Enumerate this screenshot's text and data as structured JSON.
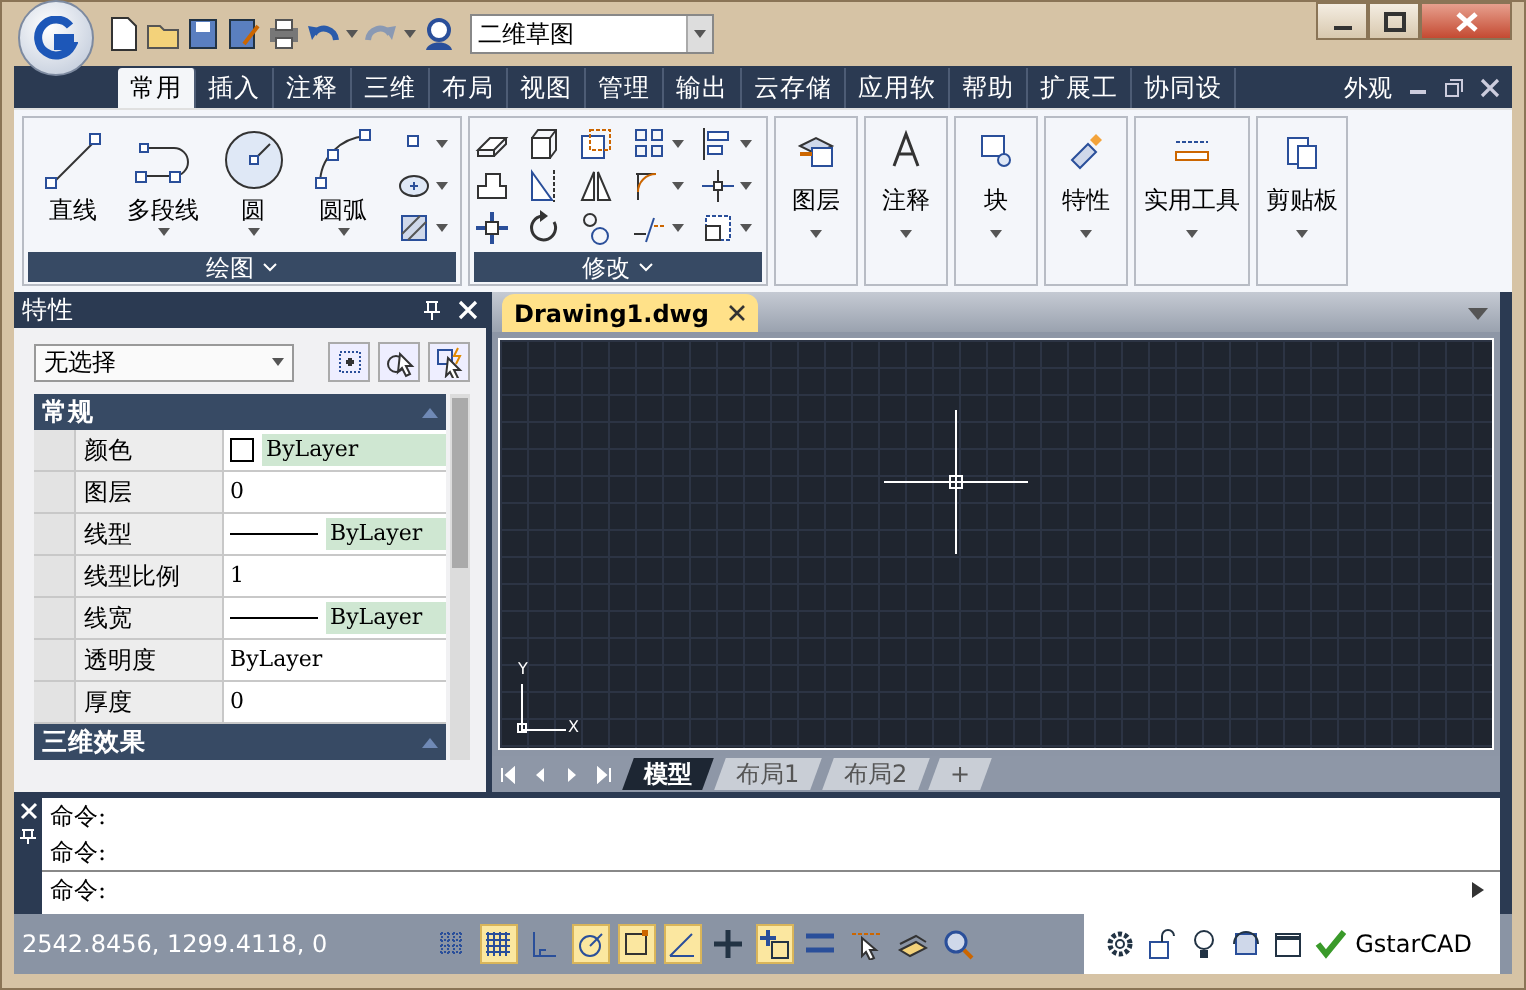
{
  "workspace": {
    "value": "二维草图"
  },
  "ribbon_tabs": [
    {
      "label": "常用",
      "selected": true
    },
    {
      "label": "插入",
      "selected": false
    },
    {
      "label": "注释",
      "selected": false
    },
    {
      "label": "三维",
      "selected": false
    },
    {
      "label": "布局",
      "selected": false
    },
    {
      "label": "视图",
      "selected": false
    },
    {
      "label": "管理",
      "selected": false
    },
    {
      "label": "输出",
      "selected": false
    },
    {
      "label": "云存储",
      "selected": false
    },
    {
      "label": "应用软",
      "selected": false
    },
    {
      "label": "帮助",
      "selected": false
    },
    {
      "label": "扩展工",
      "selected": false
    },
    {
      "label": "协同设",
      "selected": false
    }
  ],
  "appearance_menu": {
    "label": "外观"
  },
  "draw_group": {
    "title": "绘图",
    "tools": [
      {
        "label": "直线",
        "dropdown": false
      },
      {
        "label": "多段线",
        "dropdown": true
      },
      {
        "label": "圆",
        "dropdown": true
      },
      {
        "label": "圆弧",
        "dropdown": true
      }
    ]
  },
  "modify_group": {
    "title": "修改"
  },
  "panel_buttons": [
    {
      "label": "图层"
    },
    {
      "label": "注释"
    },
    {
      "label": "块"
    },
    {
      "label": "特性"
    },
    {
      "label": "实用工具"
    },
    {
      "label": "剪贴板"
    }
  ],
  "properties": {
    "title": "特性",
    "selector": "无选择",
    "sections": [
      {
        "title": "常规",
        "expanded": true,
        "rows": [
          {
            "name": "颜色",
            "value": "ByLayer",
            "kind": "color"
          },
          {
            "name": "图层",
            "value": "0",
            "kind": "text"
          },
          {
            "name": "线型",
            "value": "ByLayer",
            "kind": "line"
          },
          {
            "name": "线型比例",
            "value": "1",
            "kind": "text"
          },
          {
            "name": "线宽",
            "value": "ByLayer",
            "kind": "line"
          },
          {
            "name": "透明度",
            "value": "ByLayer",
            "kind": "text"
          },
          {
            "name": "厚度",
            "value": "0",
            "kind": "text"
          }
        ]
      },
      {
        "title": "三维效果",
        "expanded": true
      }
    ]
  },
  "document_tab": {
    "label": "Drawing1.dwg",
    "selected": true
  },
  "ucs": {
    "y": "Y",
    "x": "X"
  },
  "layout_tabs": [
    {
      "label": "模型",
      "selected": true
    },
    {
      "label": "布局1",
      "selected": false
    },
    {
      "label": "布局2",
      "selected": false
    },
    {
      "label": "+",
      "selected": false
    }
  ],
  "command_history": [
    "命令:",
    "命令:"
  ],
  "command_input": {
    "prompt": "命令:"
  },
  "status_bar": {
    "coordinates": "2542.8456, 1299.4118, 0",
    "toggles": [
      {
        "on": false
      },
      {
        "on": true
      },
      {
        "on": false
      },
      {
        "on": true
      },
      {
        "on": true
      },
      {
        "on": true
      },
      {
        "on": false
      },
      {
        "on": true
      },
      {
        "on": false
      },
      {
        "on": false
      },
      {
        "on": false
      },
      {
        "on": false
      }
    ],
    "brand": "GstarCAD"
  }
}
